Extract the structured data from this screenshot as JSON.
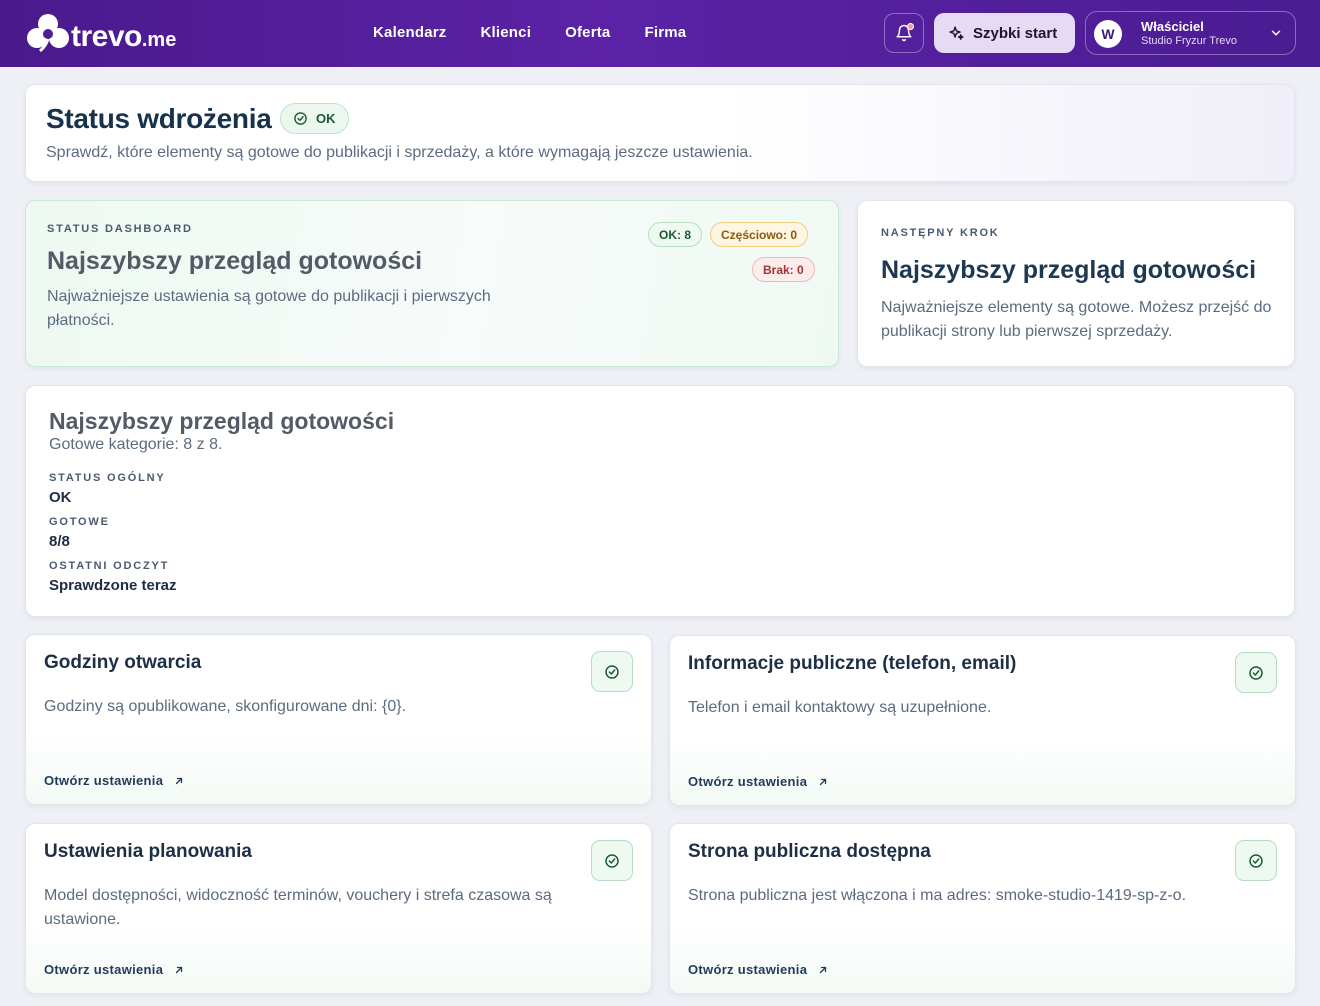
{
  "brand": {
    "name": "trevo",
    "tld": ".me"
  },
  "nav": [
    {
      "label": "Kalendarz"
    },
    {
      "label": "Klienci"
    },
    {
      "label": "Oferta"
    },
    {
      "label": "Firma"
    }
  ],
  "topbar": {
    "quick_start_label": "Szybki start",
    "account": {
      "initial": "W",
      "name": "Właściciel",
      "studio": "Studio Fryzur Trevo"
    }
  },
  "header": {
    "title": "Status wdrożenia",
    "badge": "OK",
    "subtitle": "Sprawdź, które elementy są gotowe do publikacji i sprzedaży, a które wymagają jeszcze ustawienia."
  },
  "dashboard": {
    "kicker": "STATUS DASHBOARD",
    "title": "Najszybszy przegląd gotowości",
    "description": "Najważniejsze ustawienia są gotowe do publikacji i pierwszych płatności.",
    "pills": {
      "ok": "OK: 8",
      "partial": "Częściowo: 0",
      "missing": "Brak: 0"
    }
  },
  "next_step": {
    "kicker": "NASTĘPNY KROK",
    "title": "Najszybszy przegląd gotowości",
    "description": "Najważniejsze elementy są gotowe. Możesz przejść do publikacji strony lub pierwszej sprzedaży."
  },
  "summary": {
    "title": "Najszybszy przegląd gotowości",
    "subtitle": "Gotowe kategorie: 8 z 8.",
    "fields": [
      {
        "label": "STATUS OGÓLNY",
        "value": "OK"
      },
      {
        "label": "GOTOWE",
        "value": "8/8"
      },
      {
        "label": "OSTATNI ODCZYT",
        "value": "Sprawdzone teraz"
      }
    ]
  },
  "tiles": [
    {
      "title": "Godziny otwarcia",
      "description": "Godziny są opublikowane, skonfigurowane dni: {0}.",
      "link": "Otwórz ustawienia"
    },
    {
      "title": "Informacje publiczne (telefon, email)",
      "description": "Telefon i email kontaktowy są uzupełnione.",
      "link": "Otwórz ustawienia"
    },
    {
      "title": "Ustawienia planowania",
      "description": "Model dostępności, widoczność terminów, vouchery i strefa czasowa są ustawione.",
      "link": "Otwórz ustawienia"
    },
    {
      "title": "Strona publiczna dostępna",
      "description": "Strona publiczna jest włączona i ma adres: smoke-studio-1419-sp-z-o.",
      "link": "Otwórz ustawienia"
    }
  ],
  "colors": {
    "topbar": "#4a1a8c",
    "ok_green": "#1c5a33",
    "partial_amber": "#8a5a0c",
    "missing_red": "#a23535"
  },
  "icons": {
    "bell": "bell-icon",
    "quick": "sparkle-icon",
    "chevron": "chevron-down-icon",
    "check": "check-circle-icon",
    "link": "arrow-up-right-icon"
  }
}
